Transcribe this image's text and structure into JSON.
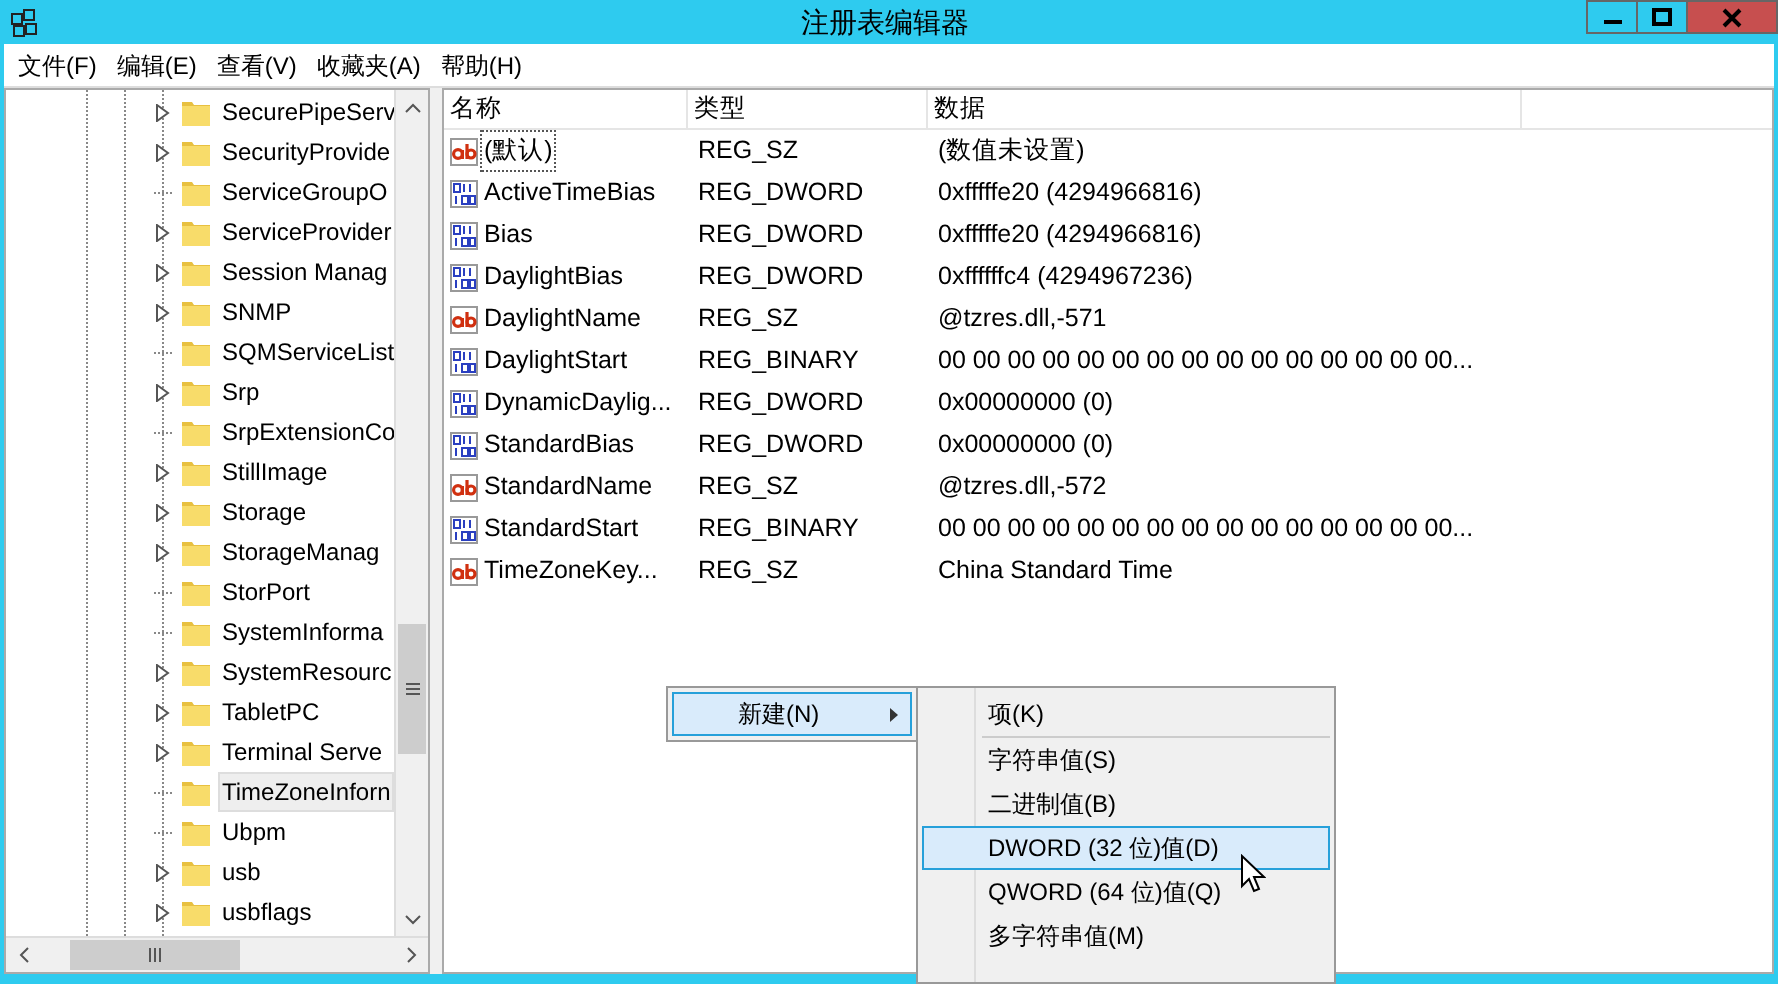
{
  "window": {
    "title": "注册表编辑器"
  },
  "menu_bar": [
    "文件(F)",
    "编辑(E)",
    "查看(V)",
    "收藏夹(A)",
    "帮助(H)"
  ],
  "tree": [
    {
      "label": "SecurePipeServ",
      "expandable": true,
      "selected": false
    },
    {
      "label": "SecurityProvide",
      "expandable": true,
      "selected": false
    },
    {
      "label": "ServiceGroupO",
      "expandable": false,
      "selected": false
    },
    {
      "label": "ServiceProvider",
      "expandable": true,
      "selected": false
    },
    {
      "label": "Session Manag",
      "expandable": true,
      "selected": false
    },
    {
      "label": "SNMP",
      "expandable": true,
      "selected": false
    },
    {
      "label": "SQMServiceList",
      "expandable": false,
      "selected": false
    },
    {
      "label": "Srp",
      "expandable": true,
      "selected": false
    },
    {
      "label": "SrpExtensionCo",
      "expandable": false,
      "selected": false
    },
    {
      "label": "StillImage",
      "expandable": true,
      "selected": false
    },
    {
      "label": "Storage",
      "expandable": true,
      "selected": false
    },
    {
      "label": "StorageManag",
      "expandable": true,
      "selected": false
    },
    {
      "label": "StorPort",
      "expandable": false,
      "selected": false
    },
    {
      "label": "SystemInforma",
      "expandable": false,
      "selected": false
    },
    {
      "label": "SystemResourc",
      "expandable": true,
      "selected": false
    },
    {
      "label": "TabletPC",
      "expandable": true,
      "selected": false
    },
    {
      "label": "Terminal Serve",
      "expandable": true,
      "selected": false
    },
    {
      "label": "TimeZoneInforn",
      "expandable": false,
      "selected": true
    },
    {
      "label": "Ubpm",
      "expandable": false,
      "selected": false
    },
    {
      "label": "usb",
      "expandable": true,
      "selected": false
    },
    {
      "label": "usbflags",
      "expandable": true,
      "selected": false
    }
  ],
  "table": {
    "columns": [
      "名称",
      "类型",
      "数据"
    ],
    "rows": [
      {
        "kind": "string",
        "name": "(默认)",
        "type": "REG_SZ",
        "data": "(数值未设置)",
        "focused": true
      },
      {
        "kind": "binary",
        "name": "ActiveTimeBias",
        "type": "REG_DWORD",
        "data": "0xfffffe20 (4294966816)",
        "focused": false
      },
      {
        "kind": "binary",
        "name": "Bias",
        "type": "REG_DWORD",
        "data": "0xfffffe20 (4294966816)",
        "focused": false
      },
      {
        "kind": "binary",
        "name": "DaylightBias",
        "type": "REG_DWORD",
        "data": "0xffffffc4 (4294967236)",
        "focused": false
      },
      {
        "kind": "string",
        "name": "DaylightName",
        "type": "REG_SZ",
        "data": "@tzres.dll,-571",
        "focused": false
      },
      {
        "kind": "binary",
        "name": "DaylightStart",
        "type": "REG_BINARY",
        "data": "00 00 00 00 00 00 00 00 00 00 00 00 00 00 00...",
        "focused": false
      },
      {
        "kind": "binary",
        "name": "DynamicDaylig...",
        "type": "REG_DWORD",
        "data": "0x00000000 (0)",
        "focused": false
      },
      {
        "kind": "binary",
        "name": "StandardBias",
        "type": "REG_DWORD",
        "data": "0x00000000 (0)",
        "focused": false
      },
      {
        "kind": "string",
        "name": "StandardName",
        "type": "REG_SZ",
        "data": "@tzres.dll,-572",
        "focused": false
      },
      {
        "kind": "binary",
        "name": "StandardStart",
        "type": "REG_BINARY",
        "data": "00 00 00 00 00 00 00 00 00 00 00 00 00 00 00...",
        "focused": false
      },
      {
        "kind": "string",
        "name": "TimeZoneKey...",
        "type": "REG_SZ",
        "data": "China Standard Time",
        "focused": false
      }
    ]
  },
  "context_menu": {
    "items": [
      {
        "label": "新建(N)",
        "has_submenu": true,
        "selected": true
      }
    ]
  },
  "submenu": {
    "items": [
      {
        "kind": "item",
        "label": "项(K)",
        "selected": false
      },
      {
        "kind": "separator"
      },
      {
        "kind": "item",
        "label": "字符串值(S)",
        "selected": false
      },
      {
        "kind": "item",
        "label": "二进制值(B)",
        "selected": false
      },
      {
        "kind": "item",
        "label": "DWORD (32 位)值(D)",
        "selected": true
      },
      {
        "kind": "item",
        "label": "QWORD (64 位)值(Q)",
        "selected": false
      },
      {
        "kind": "item",
        "label": "多字符串值(M)",
        "selected": false
      }
    ]
  }
}
